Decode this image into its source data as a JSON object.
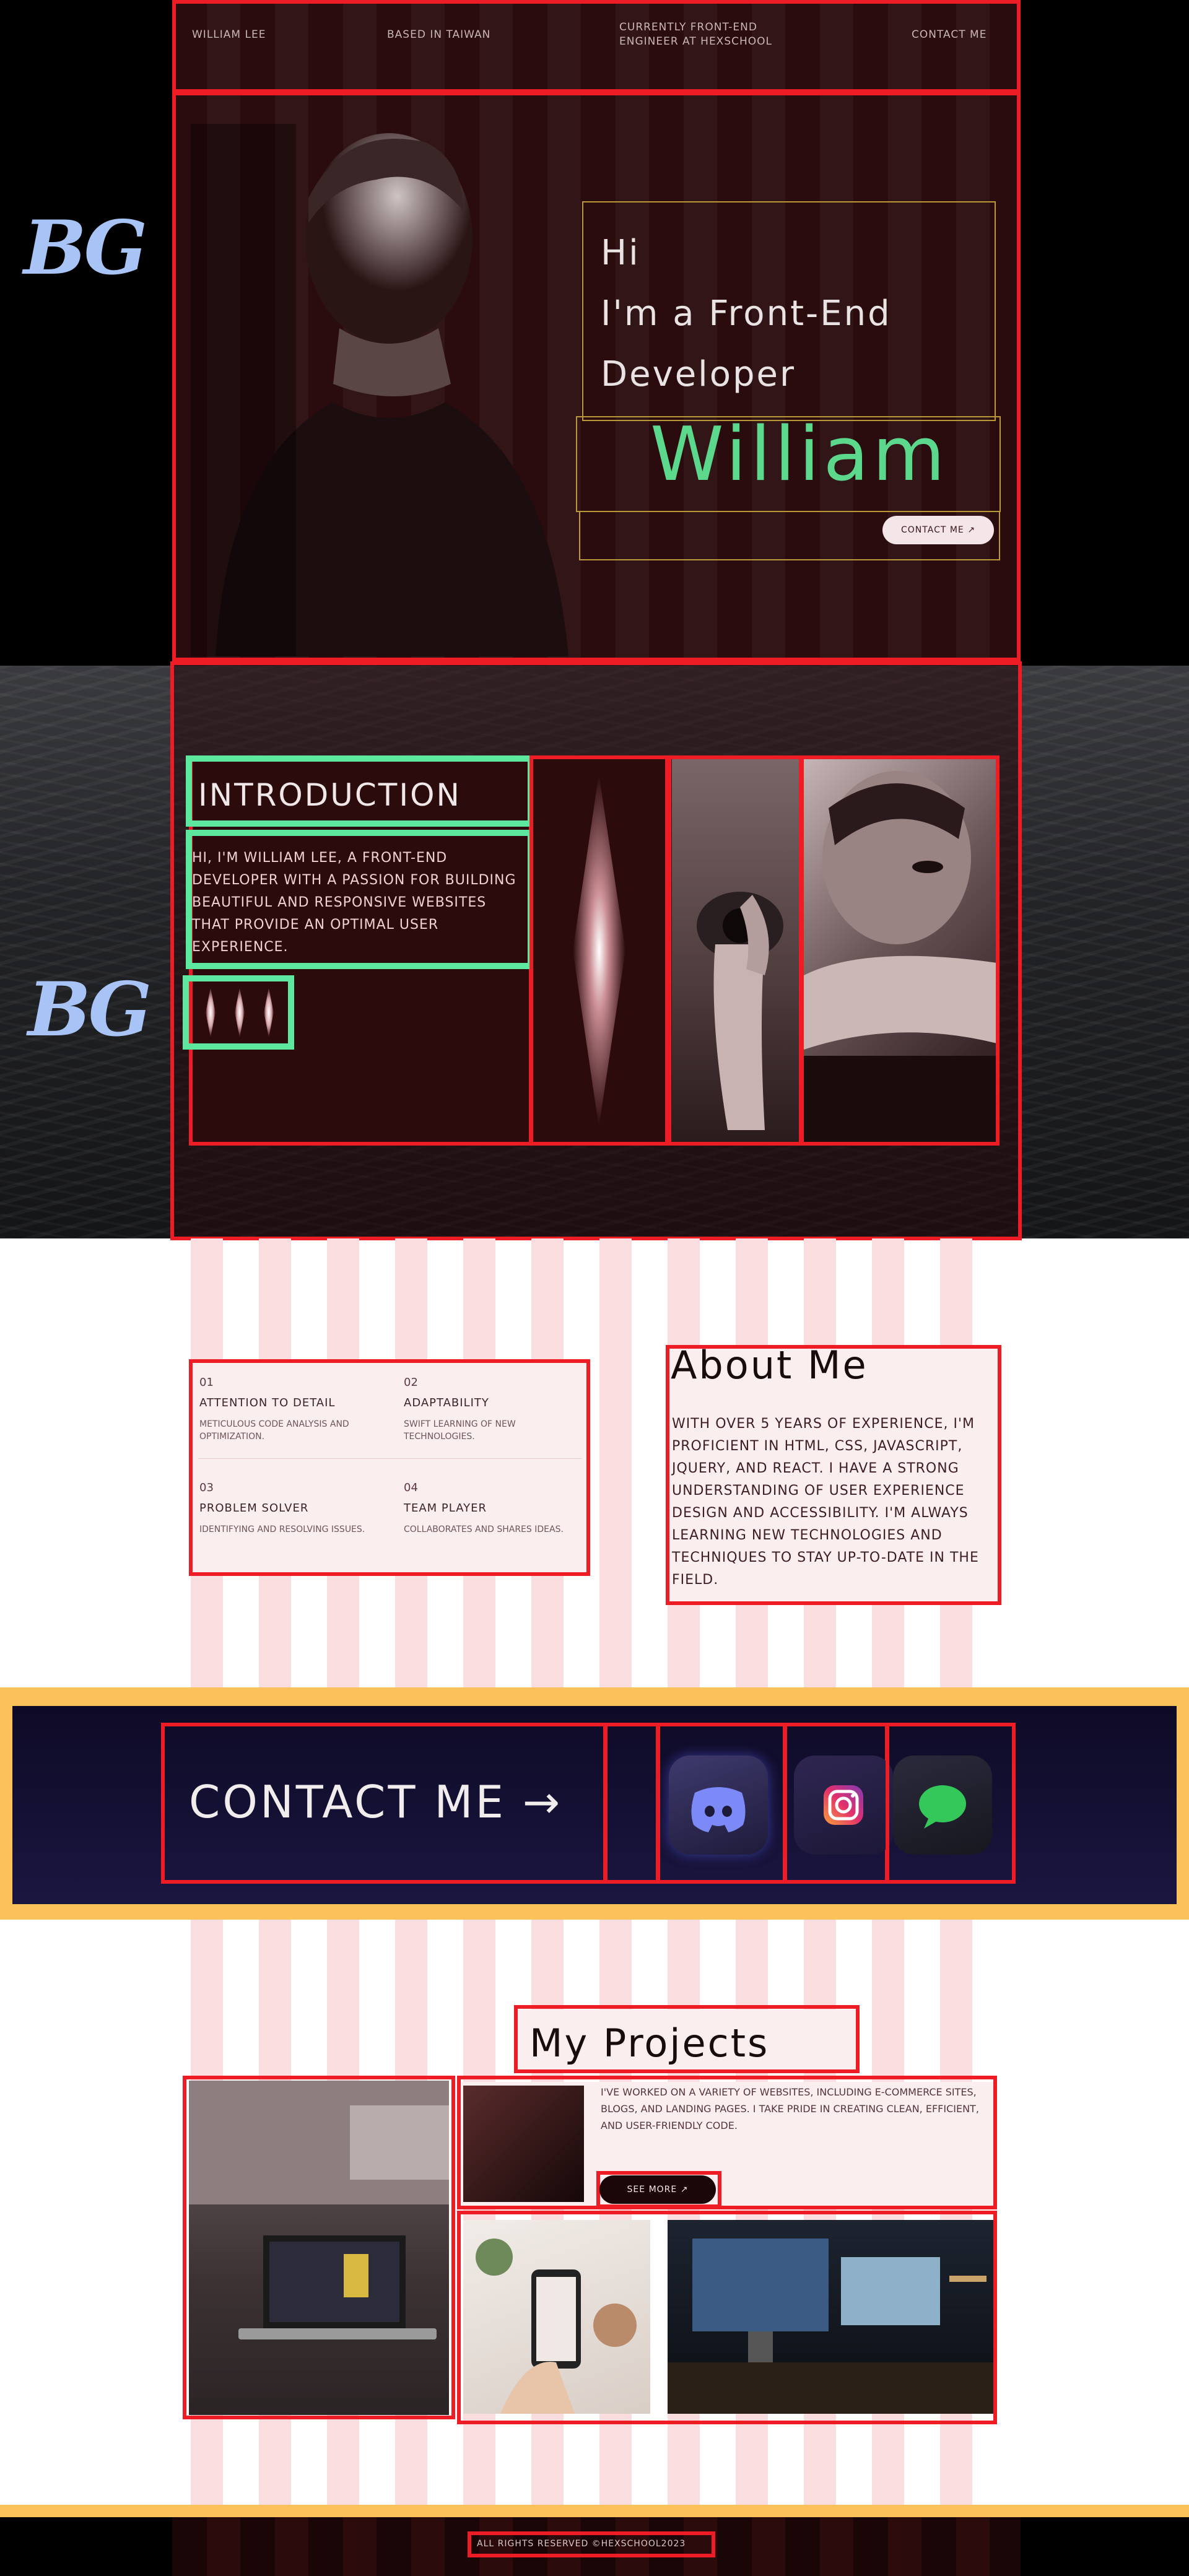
{
  "annotations": {
    "bg_label_top": "BG",
    "bg_label_mid": "BG"
  },
  "nav": {
    "name": "William Lee",
    "location": "Based in Taiwan",
    "role": "Currently Front-End Engineer at Hexschool",
    "contact": "Contact Me"
  },
  "hero": {
    "line1": "Hi",
    "line2": "I'm a Front-End",
    "line3": "Developer",
    "name": "William",
    "contact_button": "Contact Me ↗"
  },
  "intro": {
    "title": "Introduction",
    "body": "Hi, I'm William Lee, a Front-End Developer with a passion for building beautiful and responsive websites that provide an optimal user experience."
  },
  "traits": [
    {
      "num": "01",
      "title": "Attention to Detail",
      "desc": "Meticulous code analysis and optimization."
    },
    {
      "num": "02",
      "title": "Adaptability",
      "desc": "Swift learning of new technologies."
    },
    {
      "num": "03",
      "title": "Problem Solver",
      "desc": "Identifying and resolving issues."
    },
    {
      "num": "04",
      "title": "Team Player",
      "desc": "Collaborates and shares ideas."
    }
  ],
  "about": {
    "title": "About Me",
    "body": "With over 5 years of experience, I'm proficient in HTML, CSS, JavaScript, jQuery, and React. I have a strong understanding of user experience design and accessibility. I'm always learning new technologies and techniques to stay up-to-date in the field."
  },
  "contact_band": {
    "label": "CONTACT ME →",
    "apps": [
      {
        "icon": "discord-icon",
        "color": "#5865f2"
      },
      {
        "icon": "instagram-icon",
        "color": "#e1306c"
      },
      {
        "icon": "messages-icon",
        "color": "#34c759"
      }
    ]
  },
  "projects": {
    "title": "My Projects",
    "text": "I've worked on a variety of websites, including e-commerce sites, blogs, and landing pages. I take pride in creating clean, efficient, and user-friendly code.",
    "see_more": "See More ↗"
  },
  "footer": {
    "text": "All rights reserved ©HexSchool2023"
  },
  "colors": {
    "accent_green": "#5cd88c",
    "annotation_red": "#ee1c25",
    "band_gold": "#fbc15a"
  }
}
